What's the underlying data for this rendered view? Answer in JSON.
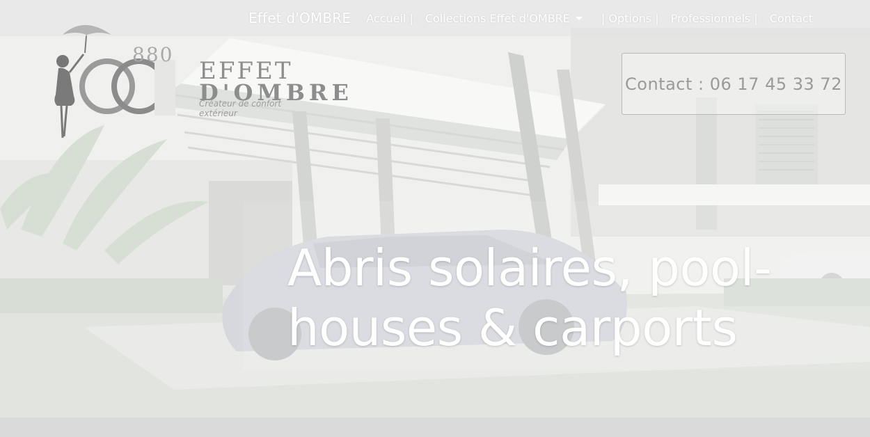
{
  "nav": {
    "brand": "Effet d'OMBRE",
    "items": [
      {
        "label": "Accueil |"
      },
      {
        "label": "Collections Effet d'OMBRE"
      },
      {
        "label": "| Options |"
      },
      {
        "label": "Professionnels |"
      },
      {
        "label": "Contact"
      }
    ],
    "dropdown_icon": "caret-down-icon"
  },
  "logo": {
    "numerals": "880",
    "line1": "EFFET",
    "line2": "D'OMBRE",
    "tagline": "Créateur de confort extérieur"
  },
  "contact": {
    "label": "Contact : 06 17 45 33 72"
  },
  "hero": {
    "headline_line1": "Abris solaires, pool-",
    "headline_line2": "houses & carports"
  },
  "colors": {
    "nav_text": "#ffffff",
    "headline_text": "#ffffff",
    "contact_text": "#9a9a9a",
    "logo_gray": "#8d8d8d"
  }
}
